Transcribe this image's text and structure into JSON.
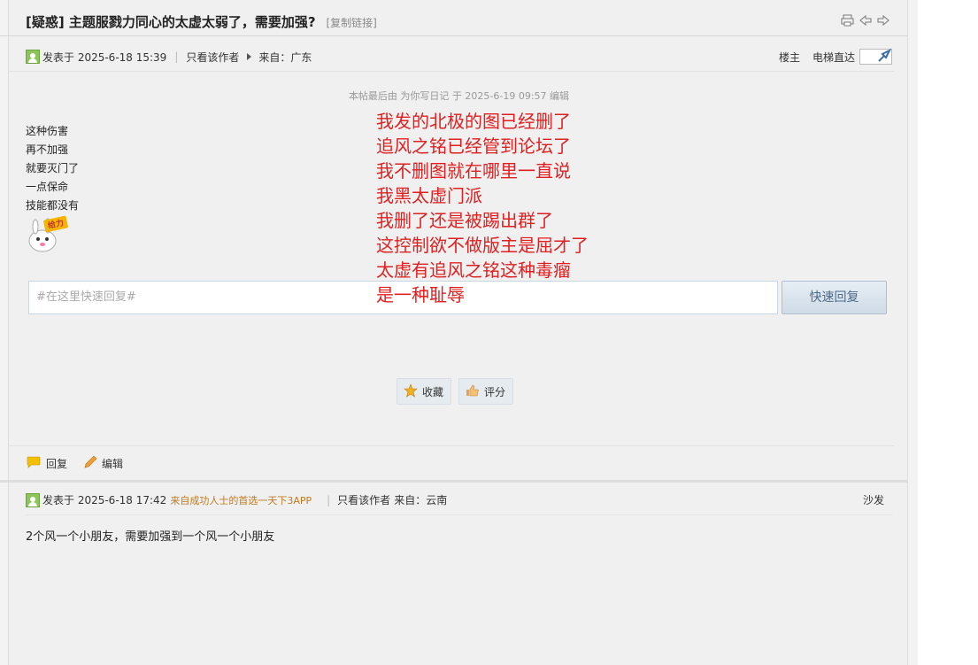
{
  "thread": {
    "title": "[疑惑] 主题服戮力同心的太虚太弱了，需要加强?",
    "copy_link": "[复制链接]"
  },
  "post1": {
    "posted_at": "发表于 2025-6-18 15:39",
    "only_author": "只看该作者",
    "from": "来自：广东",
    "floor_label": "楼主",
    "elevator_label": "电梯直达",
    "edit_note": "本帖最后由 为你写日记 于 2025-6-19 09:57 编辑",
    "lines": [
      "这种伤害",
      "再不加强",
      "就要灭门了",
      "一点保命",
      "技能都没有"
    ],
    "emoji_label": "给力"
  },
  "overlay": {
    "lines": [
      "我发的北极的图已经删了",
      "追风之铭已经管到论坛了",
      "我不删图就在哪里一直说",
      "我黑太虚门派",
      "我删了还是被踢出群了",
      "这控制欲不做版主是屈才了",
      "太虚有追风之铭这种毒瘤",
      "是一种耻辱"
    ],
    "color": "#e02020"
  },
  "quick_reply": {
    "placeholder": "#在这里快速回复#",
    "button": "快速回复"
  },
  "actions": {
    "favorite": "收藏",
    "rate": "评分",
    "reply": "回复",
    "edit": "编辑"
  },
  "post2": {
    "posted_at": "发表于 2025-6-18 17:42",
    "source": "来自成功人士的首选一天下3APP",
    "only_author": "只看该作者",
    "from": "来自：云南",
    "floor_label": "沙发",
    "body": "2个风一个小朋友，需要加强到一个风一个小朋友"
  }
}
